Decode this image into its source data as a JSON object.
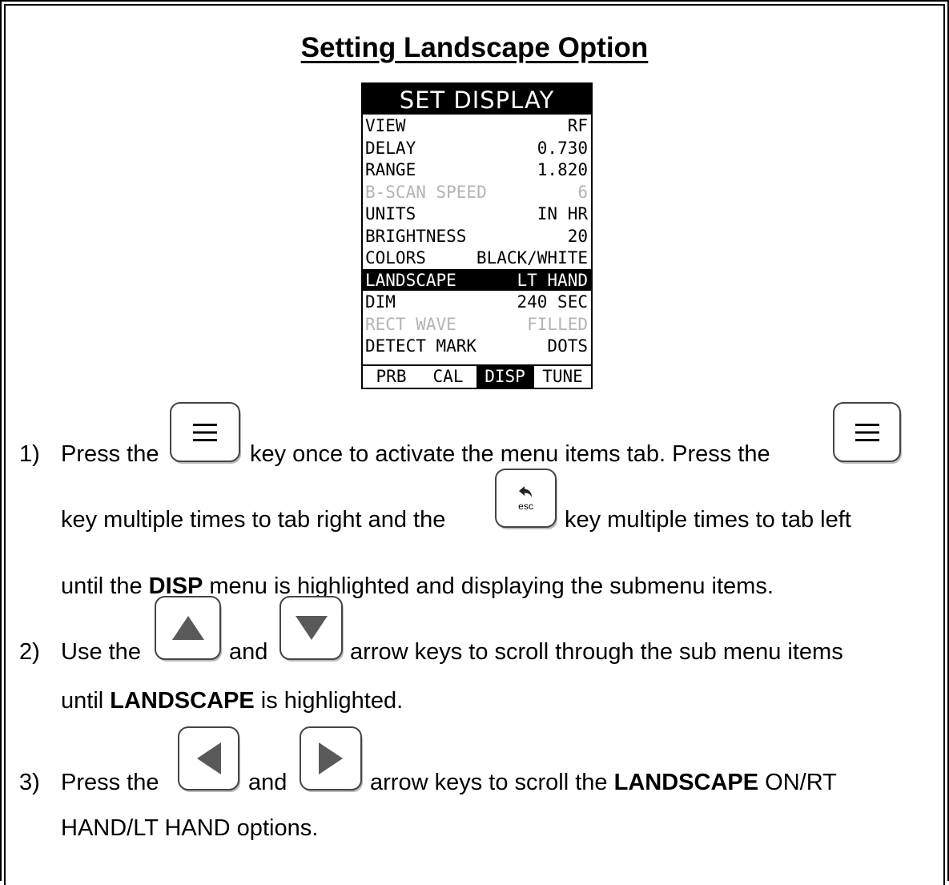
{
  "title": "Setting Landscape Option",
  "device": {
    "screen_title": "SET DISPLAY",
    "items": [
      {
        "label": "VIEW",
        "value": "RF"
      },
      {
        "label": "DELAY",
        "value": "0.730"
      },
      {
        "label": "RANGE",
        "value": "1.820"
      },
      {
        "label": "B-SCAN SPEED",
        "value": "6"
      },
      {
        "label": "UNITS",
        "value": "IN HR"
      },
      {
        "label": "BRIGHTNESS",
        "value": "20"
      },
      {
        "label": "COLORS",
        "value": "BLACK/WHITE"
      },
      {
        "label": "LANDSCAPE",
        "value": "LT HAND"
      },
      {
        "label": "DIM",
        "value": "240 SEC"
      },
      {
        "label": "RECT WAVE",
        "value": "FILLED"
      },
      {
        "label": "DETECT MARK",
        "value": "DOTS"
      }
    ],
    "tabs": [
      "PRB",
      "CAL",
      "DISP",
      "TUNE"
    ]
  },
  "keys": {
    "menu": "menu-icon",
    "esc": "esc",
    "up": "up-arrow-icon",
    "down": "down-arrow-icon",
    "left": "left-arrow-icon",
    "right": "right-arrow-icon"
  },
  "steps": {
    "s1_num": "1)",
    "s1_a": "Press the",
    "s1_b": "key once to activate the menu items tab.  Press the",
    "s1_c": "key multiple times to tab right and the",
    "s1_d": "key multiple times to tab left",
    "s1_e": "until the",
    "s1_bold1": "DISP",
    "s1_f": "menu is highlighted and displaying the submenu items.",
    "s2_num": "2)",
    "s2_a": "Use the",
    "s2_b": "and",
    "s2_c": "arrow keys to scroll through the sub menu items",
    "s2_d": "until",
    "s2_bold1": "LANDSCAPE",
    "s2_e": "is highlighted.",
    "s3_num": "3)",
    "s3_a": "Press the",
    "s3_b": "and",
    "s3_c": "arrow keys to scroll the",
    "s3_bold1": "LANDSCAPE",
    "s3_d": "ON/RT",
    "s3_e": "HAND/LT HAND options."
  }
}
